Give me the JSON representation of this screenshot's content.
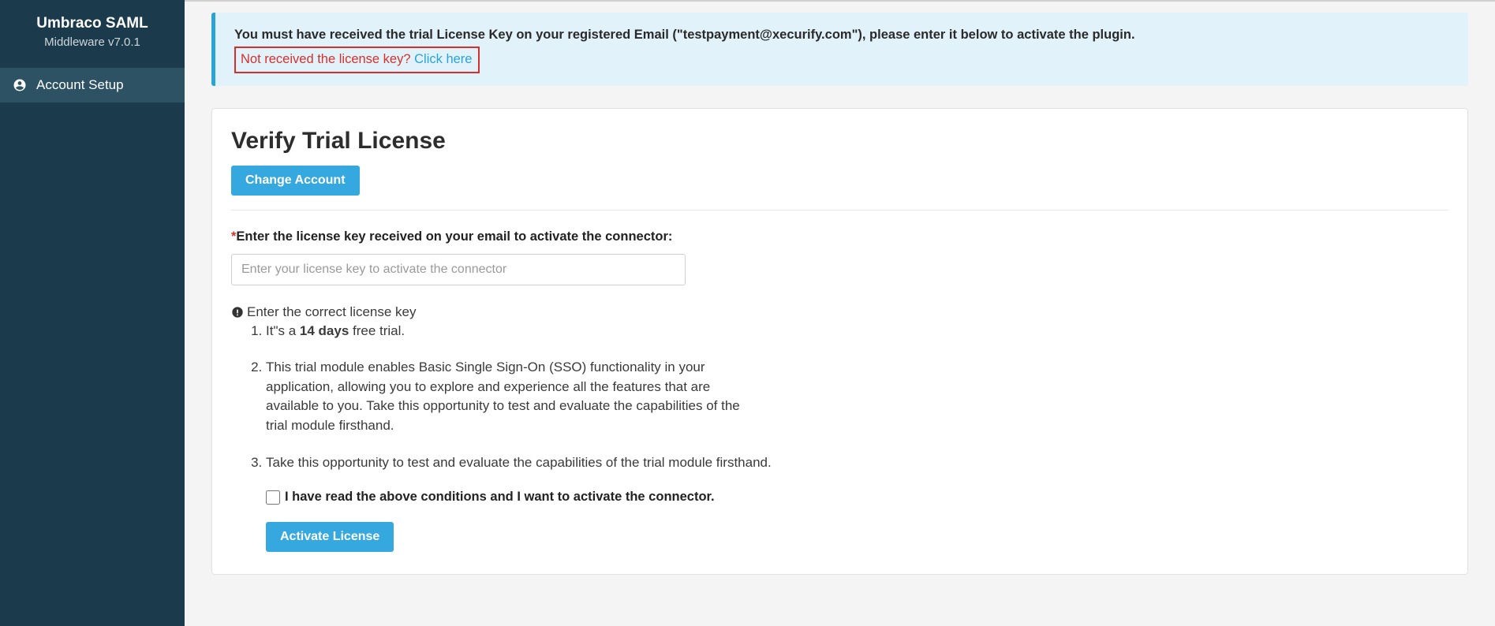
{
  "sidebar": {
    "title": "Umbraco SAML",
    "subtitle": "Middleware v7.0.1",
    "items": [
      {
        "label": "Account Setup"
      }
    ]
  },
  "alert": {
    "line1": "You must have received the trial License Key on your registered Email (\"testpayment@xecurify.com\"), please enter it below to activate the plugin.",
    "question": "Not received the license key? ",
    "link": "Click here"
  },
  "card": {
    "title": "Verify Trial License",
    "change_account": "Change Account",
    "field_label": "Enter the license key received on your email to activate the connector:",
    "input_placeholder": "Enter your license key to activate the connector",
    "warn_text": "Enter the correct license key",
    "bullets": {
      "b1_pre": "It\"s a ",
      "b1_bold": "14 days",
      "b1_post": " free trial.",
      "b2": "This trial module enables Basic Single Sign-On (SSO) functionality in your application, allowing you to explore and experience all the features that are available to you. Take this opportunity to test and evaluate the capabilities of the trial module firsthand.",
      "b3": "Take this opportunity to test and evaluate the capabilities of the trial module firsthand."
    },
    "consent_label": "I have read the above conditions and I want to activate the connector.",
    "activate_btn": "Activate License"
  }
}
